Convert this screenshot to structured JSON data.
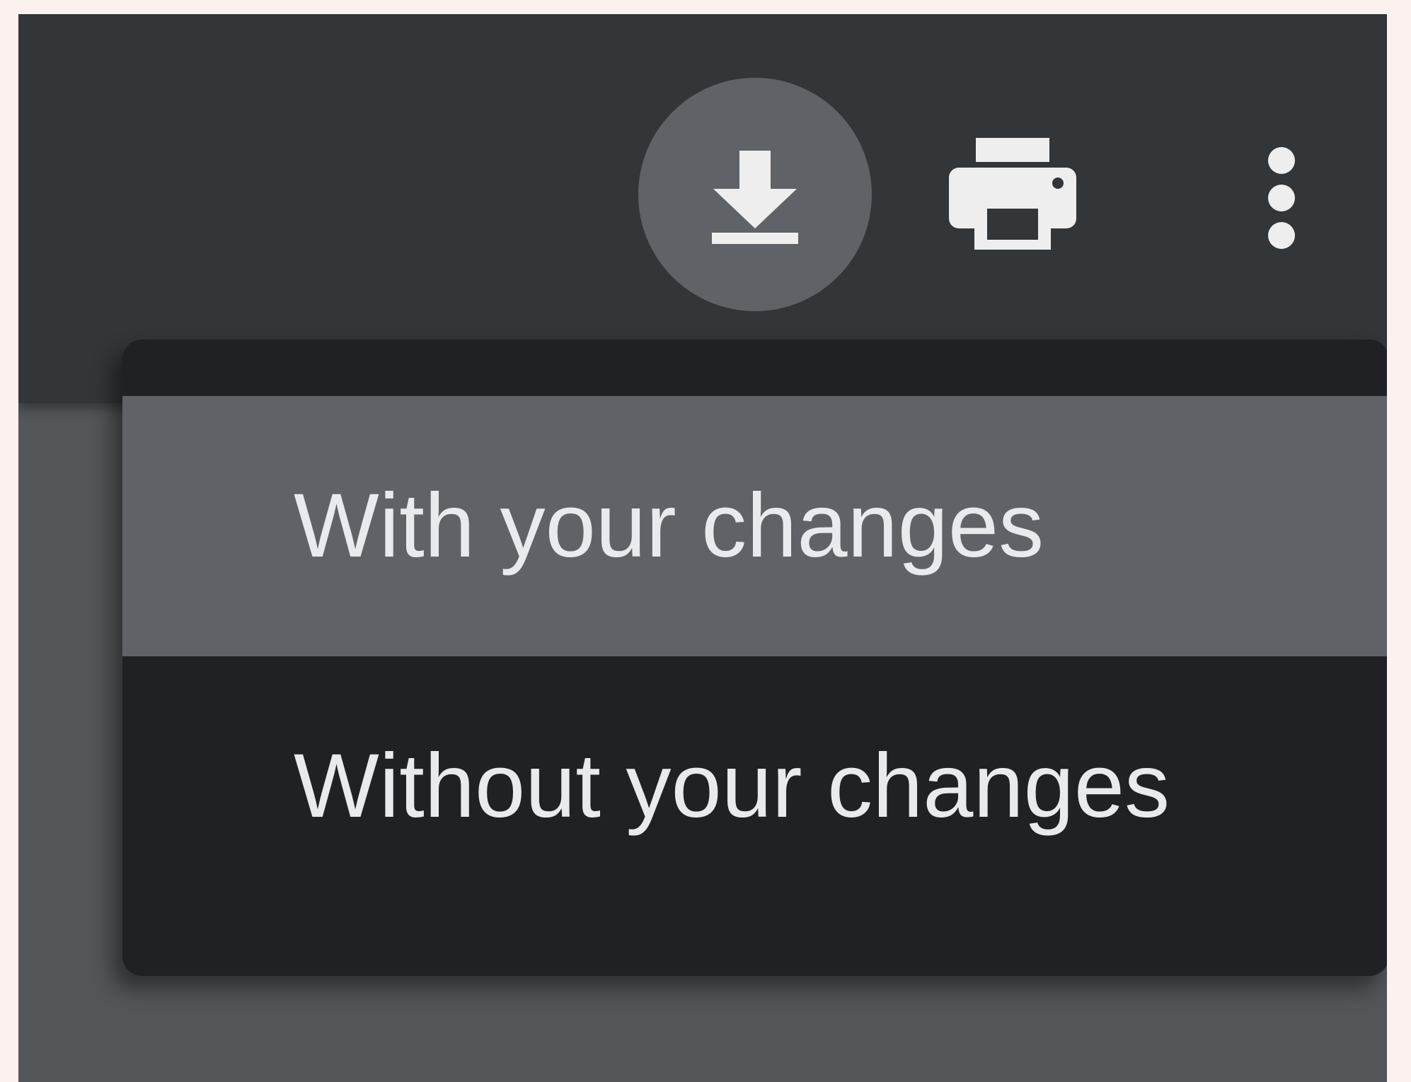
{
  "toolbar": {
    "download_icon": "download-icon",
    "print_icon": "print-icon",
    "more_icon": "more-vert-icon"
  },
  "download_menu": {
    "items": [
      {
        "label": "With your changes",
        "highlighted": true
      },
      {
        "label": "Without your changes",
        "highlighted": false
      }
    ]
  },
  "colors": {
    "toolbar_bg": "#323639",
    "viewer_bg": "#535659",
    "menu_bg": "#202124",
    "highlight_bg": "#5f6368",
    "text": "#e8eaed"
  }
}
